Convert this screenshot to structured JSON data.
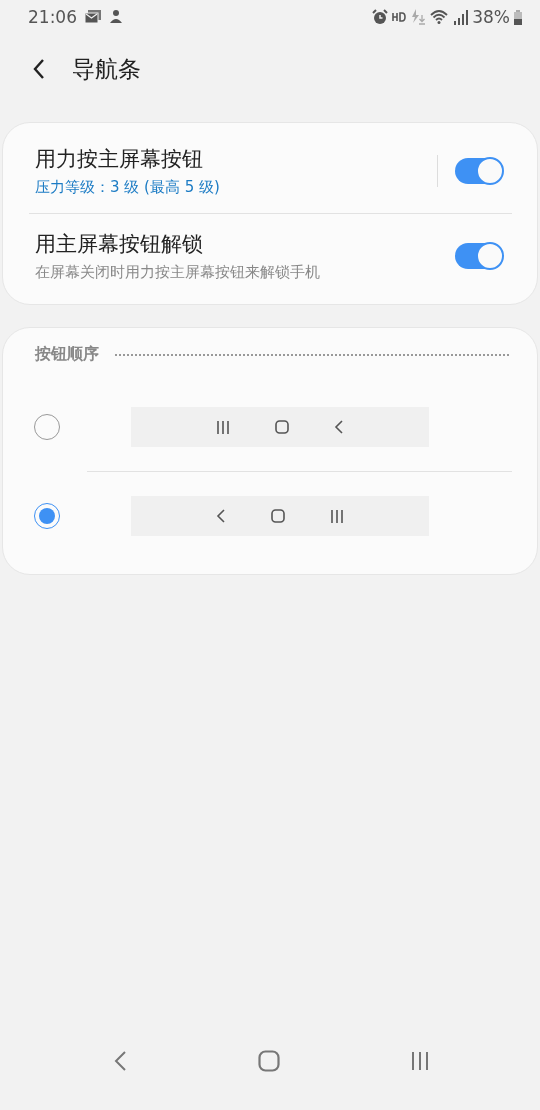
{
  "status_bar": {
    "time": "21:06",
    "battery": "38%"
  },
  "header": {
    "title": "导航条"
  },
  "settings": [
    {
      "kind": "split",
      "title": "用力按主屏幕按钮",
      "subtitle": "压力等级：3 级 (最高 5 级)",
      "on": true
    },
    {
      "kind": "plain",
      "title": "用主屏幕按钮解锁",
      "subtitle": "在屏幕关闭时用力按主屏幕按钮来解锁手机",
      "on": true
    }
  ],
  "button_order": {
    "heading": "按钮顺序",
    "options": [
      {
        "selected": false,
        "buttons": [
          {
            "kind": "recents"
          },
          {
            "kind": "home"
          },
          {
            "kind": "back"
          }
        ]
      },
      {
        "selected": true,
        "buttons": [
          {
            "kind": "back"
          },
          {
            "kind": "home"
          },
          {
            "kind": "recents"
          }
        ]
      }
    ]
  }
}
